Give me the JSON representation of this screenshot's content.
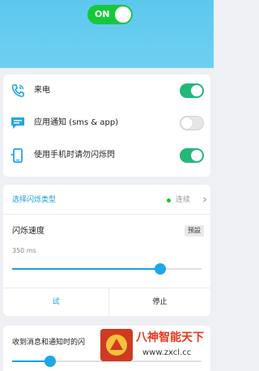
{
  "master_toggle": {
    "label": "ON",
    "state": "on",
    "color": "#16c93a"
  },
  "colors": {
    "header": "#5cc8ee",
    "accent": "#1ea8e6",
    "switch_on": "#22b87a",
    "switch_off": "#e6e6e6"
  },
  "settings": [
    {
      "icon": "phone-icon",
      "label": "来电",
      "enabled": true
    },
    {
      "icon": "chat-bubble-icon",
      "label": "应用通知 (sms & app)",
      "enabled": false
    },
    {
      "icon": "phone-flash-icon",
      "label": "使用手机时请勿闪烁閃",
      "enabled": true
    }
  ],
  "flash_type": {
    "label": "选择闪烁类型",
    "value": "连续",
    "icon": "chevron-right-icon"
  },
  "flash_speed": {
    "title": "闪烁速度",
    "preset_label": "预設",
    "value_text": "350 ms",
    "level": 0.78
  },
  "buttons": {
    "test": "试",
    "stop": "停止"
  },
  "notify_section": {
    "title": "收到消息和通知时的闪",
    "level": 0.2
  },
  "watermark": {
    "text": "八神智能天下",
    "url": "www.zxcl.cc"
  }
}
